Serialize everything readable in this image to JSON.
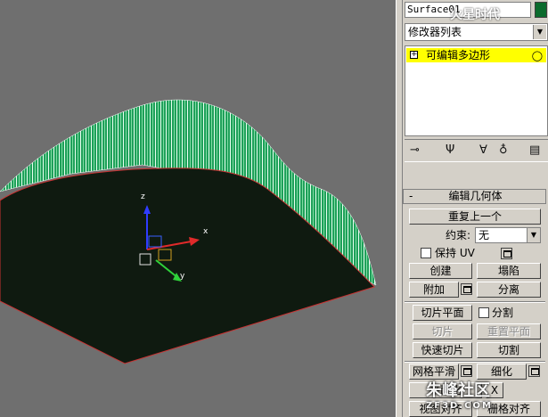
{
  "viewport": {
    "gizmo_axes": {
      "x": "x",
      "y": "y",
      "z": "z"
    }
  },
  "panel": {
    "object_name": "Surface01",
    "object_color": "#0b6b2d",
    "modifier_list": "修改器列表",
    "stack_item": "可编辑多边形",
    "rollout_title": "编辑几何体",
    "repeat_last": "重复上一个",
    "constraint_label": "约束:",
    "constraint_value": "无",
    "preserve_uv": "保持 UV",
    "create": "创建",
    "collapse": "塌陷",
    "attach": "附加",
    "detach": "分离",
    "slice_plane": "切片平面",
    "split": "分割",
    "slice": "切片",
    "reset_plane": "重置平面",
    "quick_slice": "快速切片",
    "cut": "切割",
    "meshsmooth": "网格平滑",
    "tessellate": "细化",
    "planarize": "平面化",
    "planarize_x": "X",
    "view_align": "视图对齐",
    "grid_align": "栅格对齐"
  },
  "watermarks": {
    "top": "火星时代",
    "bottom": "朱峰社区",
    "bottom_url": "ZF3D.COM"
  }
}
